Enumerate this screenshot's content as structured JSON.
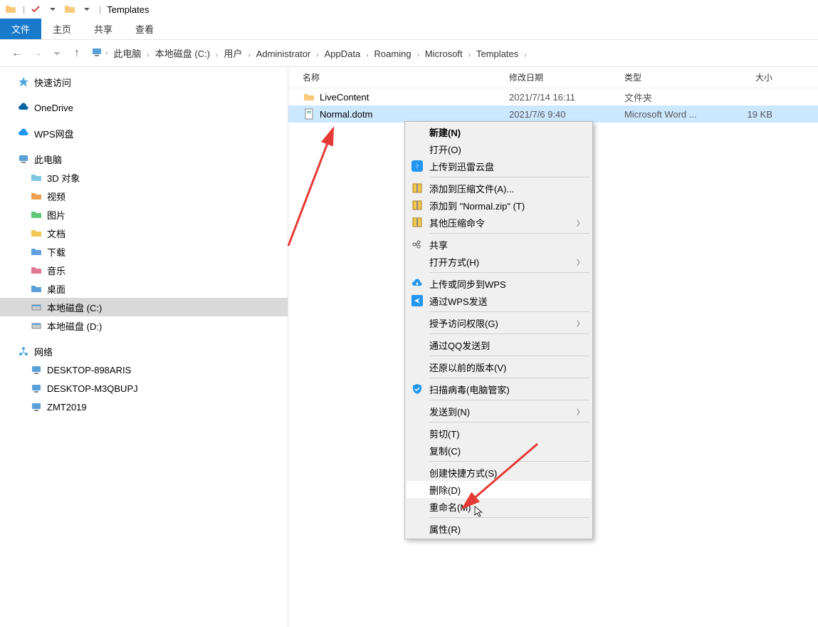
{
  "titlebar": {
    "title": "Templates"
  },
  "ribbon": {
    "file": "文件",
    "tabs": [
      "主页",
      "共享",
      "查看"
    ]
  },
  "breadcrumb": [
    "此电脑",
    "本地磁盘 (C:)",
    "用户",
    "Administrator",
    "AppData",
    "Roaming",
    "Microsoft",
    "Templates"
  ],
  "columns": {
    "name": "名称",
    "date": "修改日期",
    "type": "类型",
    "size": "大小"
  },
  "files": [
    {
      "name": "LiveContent",
      "date": "2021/7/14 16:11",
      "type": "文件夹",
      "size": "",
      "is_folder": true
    },
    {
      "name": "Normal.dotm",
      "date": "2021/7/6 9:40",
      "type": "Microsoft Word ...",
      "size": "19 KB",
      "is_folder": false
    }
  ],
  "sidebar": {
    "quick_access": "快速访问",
    "onedrive": "OneDrive",
    "wps": "WPS网盘",
    "this_pc": "此电脑",
    "this_pc_children": [
      "3D 对象",
      "视频",
      "图片",
      "文档",
      "下载",
      "音乐",
      "桌面",
      "本地磁盘 (C:)",
      "本地磁盘 (D:)"
    ],
    "network": "网络",
    "network_children": [
      "DESKTOP-898ARIS",
      "DESKTOP-M3QBUPJ",
      "ZMT2019"
    ]
  },
  "context_menu": [
    {
      "label": "新建(N)",
      "bold": true
    },
    {
      "label": "打开(O)"
    },
    {
      "label": "上传到迅雷云盘",
      "icon": "xunlei"
    },
    {
      "sep": true
    },
    {
      "label": "添加到压缩文件(A)...",
      "icon": "zip"
    },
    {
      "label": "添加到 \"Normal.zip\" (T)",
      "icon": "zip"
    },
    {
      "label": "其他压缩命令",
      "icon": "zip",
      "submenu": true
    },
    {
      "sep": true
    },
    {
      "label": "共享",
      "icon": "share"
    },
    {
      "label": "打开方式(H)",
      "submenu": true
    },
    {
      "sep": true
    },
    {
      "label": "上传或同步到WPS",
      "icon": "wps-up"
    },
    {
      "label": "通过WPS发送",
      "icon": "wps-send"
    },
    {
      "sep": true
    },
    {
      "label": "授予访问权限(G)",
      "submenu": true
    },
    {
      "sep": true
    },
    {
      "label": "通过QQ发送到"
    },
    {
      "sep": true
    },
    {
      "label": "还原以前的版本(V)"
    },
    {
      "sep": true
    },
    {
      "label": "扫描病毒(电脑管家)",
      "icon": "shield"
    },
    {
      "sep": true
    },
    {
      "label": "发送到(N)",
      "submenu": true
    },
    {
      "sep": true
    },
    {
      "label": "剪切(T)"
    },
    {
      "label": "复制(C)"
    },
    {
      "sep": true
    },
    {
      "label": "创建快捷方式(S)"
    },
    {
      "label": "删除(D)",
      "hover": true
    },
    {
      "label": "重命名(M)"
    },
    {
      "sep": true
    },
    {
      "label": "属性(R)"
    }
  ]
}
